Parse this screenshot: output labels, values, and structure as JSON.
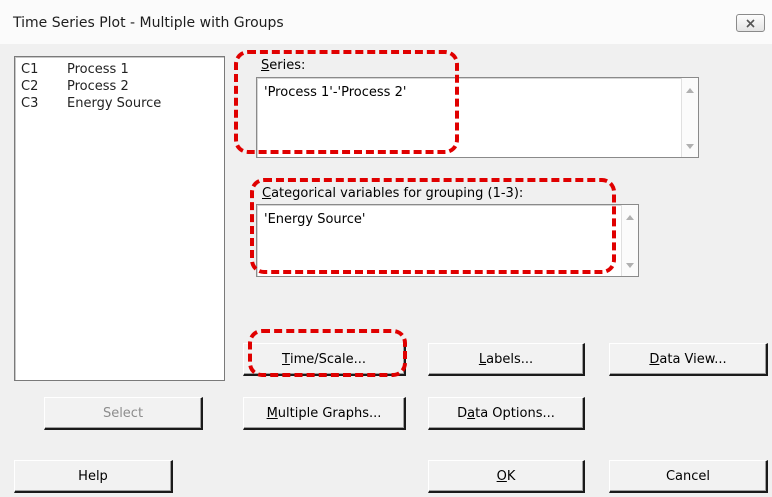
{
  "window": {
    "title": "Time Series Plot - Multiple with Groups"
  },
  "variables": [
    {
      "col": "C1",
      "name": "Process 1"
    },
    {
      "col": "C2",
      "name": "Process 2"
    },
    {
      "col": "C3",
      "name": "Energy Source"
    }
  ],
  "series": {
    "label_mnemonic": "S",
    "label_rest": "eries:",
    "value": "'Process 1'-'Process 2'"
  },
  "grouping": {
    "label_mnemonic": "C",
    "label_rest": "ategorical variables for grouping (1-3):",
    "value": "'Energy Source'"
  },
  "buttons": {
    "time_scale": {
      "m": "T",
      "rest": "ime/Scale..."
    },
    "labels": {
      "m": "L",
      "rest": "abels..."
    },
    "data_view": {
      "m": "D",
      "rest": "ata View..."
    },
    "select": "Select",
    "multiple_graphs": {
      "m": "M",
      "rest": "ultiple Graphs..."
    },
    "data_options": {
      "pre": "D",
      "m": "a",
      "rest": "ta Options..."
    },
    "help": "Help",
    "ok": {
      "m": "O",
      "rest": "K"
    },
    "cancel": "Cancel"
  },
  "colors": {
    "highlight": "#e00000"
  }
}
